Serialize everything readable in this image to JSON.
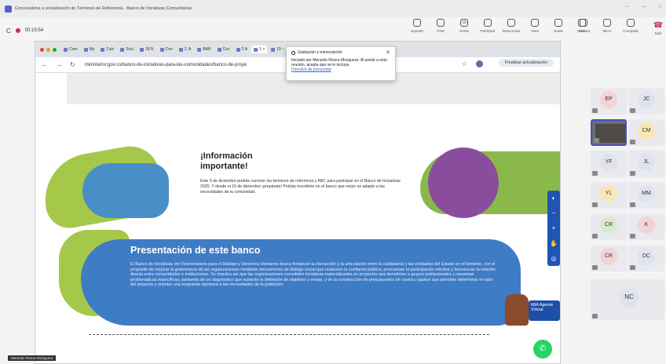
{
  "window": {
    "title": "Convocatoria a socialización de Términos de Referencia - Banco de Iniciativas Comunitarias"
  },
  "meeting": {
    "timer": "00:15:54",
    "tools": [
      {
        "icon": "share-icon",
        "label": "Soporte"
      },
      {
        "icon": "chat-icon",
        "label": "Chat"
      },
      {
        "icon": "people-icon",
        "label": "Gente",
        "badge": "18"
      },
      {
        "icon": "raise-hand-icon",
        "label": "Participar"
      },
      {
        "icon": "react-icon",
        "label": "Reaccionar"
      },
      {
        "icon": "view-icon",
        "label": "Vista"
      },
      {
        "icon": "notes-icon",
        "label": "Notas"
      },
      {
        "icon": "more-icon",
        "label": "Más"
      }
    ],
    "media": [
      {
        "icon": "camera-icon",
        "label": "Cámara"
      },
      {
        "icon": "mic-icon",
        "label": "Micro"
      },
      {
        "icon": "share-screen-icon",
        "label": "Compartir"
      }
    ],
    "leave_label": "Salir"
  },
  "browser": {
    "tabs": [
      "Com",
      "My",
      "Calc",
      "Soci",
      "18 N",
      "Con",
      "2. A",
      "BAN",
      "Coc",
      "2.A",
      "1 ×",
      "19 –",
      "Tus",
      "+"
    ],
    "url": "mininterior.gov.co/banco-de-iniciativas-para-las-comunidades/banco-de-proye",
    "finish_label": "Finalizar actualización",
    "profile_initial": "M"
  },
  "page": {
    "info_title": "¡Información importante!",
    "info_text": "Este 5 de diciembre podrás conocer los términos de referencia y ABC para participar en el Banco de Iniciativas 2025. Y desde el 15 de diciembre ¡prepárate! Podrás inscribirte en el banco que mejor se adapte a las necesidades de tu comunidad.",
    "banner_title": "Presentación de este banco",
    "banner_text": "El Banco de Iniciativas del Viceministerio para el Diálogo y Derechos Humanos busca fortalecer la interacción y la articulación entre la ciudadanía y las entidades del Estado en el territorio, con el propósito de mejorar la gobernanza de las organizaciones mediante mecanismos de diálogo social que restauren la confianza pública, promuevan la participación efectiva y favorezcan la relación directa entre comunidades e instituciones. Se impulsa así que las organizaciones consoliden iniciativas materializadas en proyectos que beneficien a grupos poblacionales y resuelvan problemáticas específicas, partiendo de un diagnóstico que sustente la definición de objetivos y metas, y de la construcción de presupuestos de costos y gastos que permitan determinar el valor del proyecto y orientar una respuesta oportuna a las necesidades de la población.",
    "mia_label": "MIA Agente Virtual"
  },
  "popup": {
    "title": "Grabación y transcripción",
    "text": "Iniciado por Merardo Rivera Mosquera. Al asistir a esta reunión, acepta que se le incluya.",
    "link": "Directiva de privacidad"
  },
  "participants": [
    {
      "initials": "EP",
      "color": "#f3d3d6"
    },
    {
      "initials": "JC",
      "color": "#dfe3ee"
    },
    {
      "initials": "",
      "color": "",
      "video": true
    },
    {
      "initials": "CM",
      "color": "#f6e7b8"
    },
    {
      "initials": "YF",
      "color": "#dfe3ee"
    },
    {
      "initials": "JL",
      "color": "#dfe3ee"
    },
    {
      "initials": "YL",
      "color": "#f6e7b8"
    },
    {
      "initials": "MM",
      "color": "#dfe3ee"
    },
    {
      "initials": "CR",
      "color": "#d9ead3"
    },
    {
      "initials": "K",
      "color": "#f3d3d6"
    },
    {
      "initials": "CR",
      "color": "#f3d3d6"
    },
    {
      "initials": "DC",
      "color": "#dfe3ee"
    },
    {
      "initials": "NC",
      "color": "#dfe3ee"
    }
  ],
  "presenter": "Merardo Rivera Mosquera"
}
